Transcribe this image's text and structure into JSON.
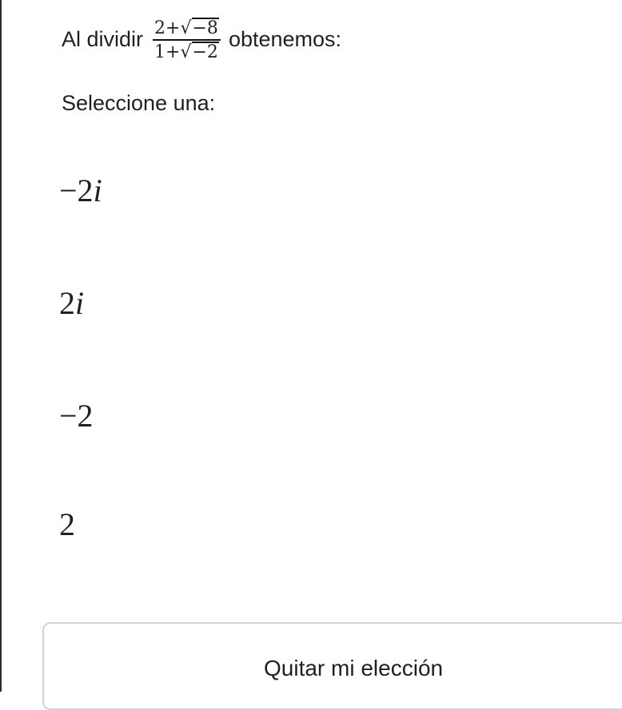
{
  "question": {
    "before": "Al dividir",
    "fraction": {
      "numerator": {
        "lead": "2+",
        "radicand": "−8"
      },
      "denominator": {
        "lead": "1+",
        "radicand": "−2"
      }
    },
    "after": "obtenemos:"
  },
  "prompt": "Seleccione una:",
  "options": [
    {
      "number": "−2",
      "var": "i"
    },
    {
      "number": "2",
      "var": "i"
    },
    {
      "number": "−2",
      "var": ""
    },
    {
      "number": "2",
      "var": ""
    }
  ],
  "clear_button": {
    "label": "Quitar mi elección"
  }
}
